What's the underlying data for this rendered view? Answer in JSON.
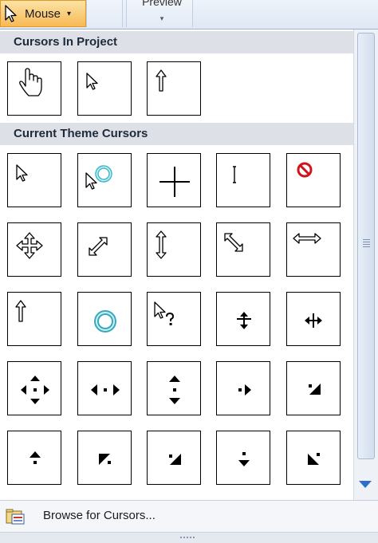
{
  "ribbon": {
    "mouse_label": "Mouse",
    "mouse_dropdown": "▾",
    "preview_label": "Preview",
    "preview_dropdown": "▾"
  },
  "sections": {
    "project_header": "Cursors In Project",
    "theme_header": "Current Theme Cursors"
  },
  "project_cursors": [
    "hand-cursor-icon",
    "arrow-cursor-icon",
    "up-arrow-cursor-icon"
  ],
  "theme_cursors": [
    [
      "arrow-cursor-icon",
      "working-in-background-cursor-icon",
      "crosshair-cursor-icon",
      "text-select-cursor-icon",
      "unavailable-cursor-icon"
    ],
    [
      "move-cursor-icon",
      "resize-diagonal-ne-cursor-icon",
      "resize-vertical-cursor-icon",
      "resize-diagonal-nw-cursor-icon",
      "resize-horizontal-cursor-icon"
    ],
    [
      "up-arrow-cursor-icon",
      "busy-cursor-icon",
      "help-select-cursor-icon",
      "split-vertical-cursor-icon",
      "split-horizontal-cursor-icon"
    ],
    [
      "pan-all-cursor-icon",
      "pan-horizontal-cursor-icon",
      "pan-vertical-cursor-icon",
      "pan-east-cursor-icon",
      "pan-southeast-cursor-icon"
    ],
    [
      "pan-north-cursor-icon",
      "pan-northwest-cursor-icon",
      "pan-northeast-cursor-icon",
      "pan-south-cursor-icon",
      "pan-southwest-cursor-icon"
    ]
  ],
  "footer": {
    "browse_label": "Browse for Cursors..."
  },
  "colors": {
    "ribbon_active": "#f7b955",
    "header_bg": "#dde1e7",
    "scroll_arrow": "#2d6ec9",
    "unavailable_red": "#d0141b"
  }
}
